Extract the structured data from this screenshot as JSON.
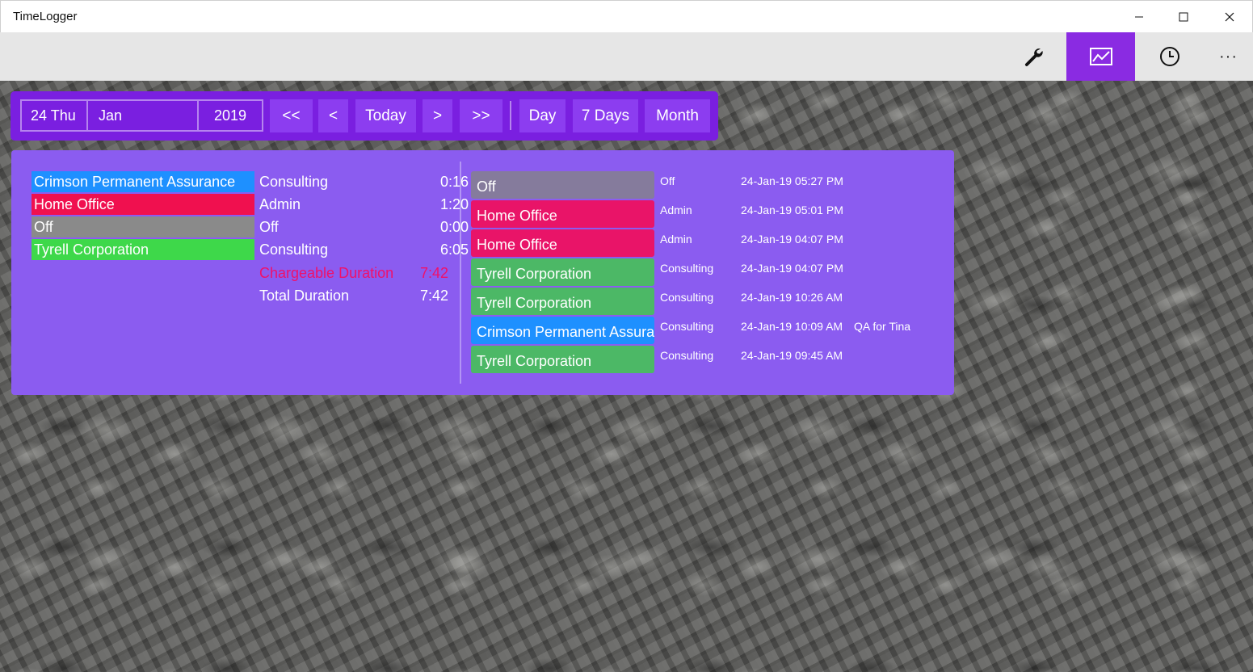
{
  "window": {
    "title": "TimeLogger"
  },
  "command_bar": {
    "buttons": [
      {
        "name": "settings",
        "icon": "wrench-icon"
      },
      {
        "name": "report",
        "icon": "chart-icon",
        "active": true
      },
      {
        "name": "timer",
        "icon": "clock-icon"
      },
      {
        "name": "more",
        "icon": "more-icon",
        "label": "···"
      }
    ],
    "accent": "#8a2be2"
  },
  "date_picker": {
    "day": "24 Thu",
    "month": "Jan",
    "year": "2019"
  },
  "navigation": {
    "first": "<<",
    "prev": "<",
    "today": "Today",
    "next": ">",
    "last": ">>",
    "day": "Day",
    "seven_days": "7 Days",
    "month": "Month"
  },
  "summary": {
    "rows": [
      {
        "client": "Crimson Permanent Assurance",
        "activity": "Consulting",
        "duration": "0:16",
        "color": "#1e90ff"
      },
      {
        "client": "Home Office",
        "activity": "Admin",
        "duration": "1:20",
        "color": "#f0104f"
      },
      {
        "client": "Off",
        "activity": "Off",
        "duration": "0:00",
        "color": "#8a8a8a"
      },
      {
        "client": "Tyrell Corporation",
        "activity": "Consulting",
        "duration": "6:05",
        "color": "#3ed84a"
      }
    ],
    "chargeable_label": "Chargeable Duration",
    "chargeable_value": "7:42",
    "chargeable_color": "#f0106a",
    "total_label": "Total Duration",
    "total_value": "7:42"
  },
  "entries": [
    {
      "client": "Off",
      "activity": "Off",
      "time": "24-Jan-19 05:27 PM",
      "note": "",
      "color": "#857b9c"
    },
    {
      "client": "Home Office",
      "activity": "Admin",
      "time": "24-Jan-19 05:01 PM",
      "note": "",
      "color": "#e91468"
    },
    {
      "client": "Home Office",
      "activity": "Admin",
      "time": "24-Jan-19 04:07 PM",
      "note": "",
      "color": "#e91468"
    },
    {
      "client": "Tyrell Corporation",
      "activity": "Consulting",
      "time": "24-Jan-19 04:07 PM",
      "note": "",
      "color": "#4cb866"
    },
    {
      "client": "Tyrell Corporation",
      "activity": "Consulting",
      "time": "24-Jan-19 10:26 AM",
      "note": "",
      "color": "#4cb866"
    },
    {
      "client": "Crimson Permanent Assurance",
      "activity": "Consulting",
      "time": "24-Jan-19 10:09 AM",
      "note": "QA for Tina",
      "color": "#1e90ff"
    },
    {
      "client": "Tyrell Corporation",
      "activity": "Consulting",
      "time": "24-Jan-19 09:45 AM",
      "note": "",
      "color": "#4cb866"
    }
  ]
}
